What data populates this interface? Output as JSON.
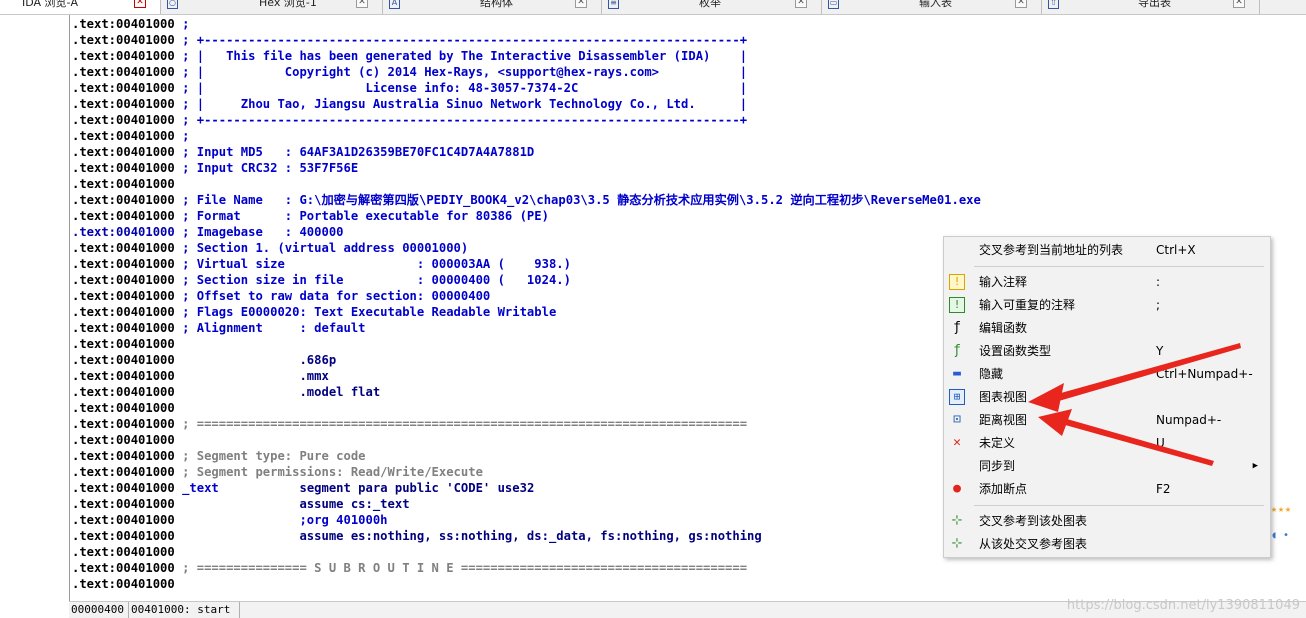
{
  "tabs": [
    {
      "label": "IDA 浏览-A",
      "icon": "ida-view-icon",
      "active": true
    },
    {
      "label": "Hex 浏览-1",
      "icon": "hex-view-icon",
      "active": false
    },
    {
      "label": "结构体",
      "icon": "structures-icon",
      "active": false
    },
    {
      "label": "枚举",
      "icon": "enums-icon",
      "active": false
    },
    {
      "label": "输入表",
      "icon": "imports-icon",
      "active": false
    },
    {
      "label": "导出表",
      "icon": "exports-icon",
      "active": false
    }
  ],
  "code_lines": [
    [
      ".text:00401000",
      " ;"
    ],
    [
      ".text:00401000",
      " ; +-------------------------------------------------------------------------+"
    ],
    [
      ".text:00401000",
      " ; |   This file has been generated by The Interactive Disassembler (IDA)    |"
    ],
    [
      ".text:00401000",
      " ; |           Copyright (c) 2014 Hex-Rays, <support@hex-rays.com>           |"
    ],
    [
      ".text:00401000",
      " ; |                      License info: 48-3057-7374-2C                      |"
    ],
    [
      ".text:00401000",
      " ; |     Zhou Tao, Jiangsu Australia Sinuo Network Technology Co., Ltd.      |"
    ],
    [
      ".text:00401000",
      " ; +-------------------------------------------------------------------------+"
    ],
    [
      ".text:00401000",
      " ;"
    ],
    [
      ".text:00401000",
      " ; Input MD5   : 64AF3A1D26359BE70FC1C4D7A4A7881D"
    ],
    [
      ".text:00401000",
      " ; Input CRC32 : 53F7F56E"
    ],
    [
      ".text:00401000",
      ""
    ],
    [
      ".text:00401000",
      " ; File Name   : G:\\加密与解密第四版\\PEDIY_BOOK4_v2\\chap03\\3.5 静态分析技术应用实例\\3.5.2 逆向工程初步\\ReverseMe01.exe"
    ],
    [
      ".text:00401000",
      " ; Format      : Portable executable for 80386 (PE)"
    ],
    [
      ".text:00401000",
      " ; Imagebase   : 400000"
    ],
    [
      ".text:00401000",
      " ; Section 1. (virtual address 00001000)"
    ],
    [
      ".text:00401000",
      " ; Virtual size                  : 000003AA (    938.)"
    ],
    [
      ".text:00401000",
      " ; Section size in file          : 00000400 (   1024.)"
    ],
    [
      ".text:00401000",
      " ; Offset to raw data for section: 00000400"
    ],
    [
      ".text:00401000",
      " ; Flags E0000020: Text Executable Readable Writable"
    ],
    [
      ".text:00401000",
      " ; Alignment     : default"
    ],
    [
      ".text:00401000",
      ""
    ],
    [
      ".text:00401000",
      "                 .686p"
    ],
    [
      ".text:00401000",
      "                 .mmx"
    ],
    [
      ".text:00401000",
      "                 .model flat"
    ],
    [
      ".text:00401000",
      ""
    ],
    [
      ".text:00401000",
      " ; ==========================================================================="
    ],
    [
      ".text:00401000",
      ""
    ],
    [
      ".text:00401000",
      " ; Segment type: Pure code"
    ],
    [
      ".text:00401000",
      " ; Segment permissions: Read/Write/Execute"
    ],
    [
      ".text:00401000",
      " _text           segment para public 'CODE' use32"
    ],
    [
      ".text:00401000",
      "                 assume cs:_text"
    ],
    [
      ".text:00401000",
      "                 ;org 401000h"
    ],
    [
      ".text:00401000",
      "                 assume es:nothing, ss:nothing, ds:_data, fs:nothing, gs:nothing"
    ],
    [
      ".text:00401000",
      ""
    ],
    [
      ".text:00401000",
      " ; =============== S U B R O U T I N E ======================================="
    ],
    [
      ".text:00401000",
      ""
    ]
  ],
  "status": {
    "offset": "00000400",
    "location": "00401000: start"
  },
  "watermark": "https://blog.csdn.net/ly1390811049",
  "context_menu": [
    {
      "label": "交叉参考到当前地址的列表",
      "key": "Ctrl+X",
      "icon": ""
    },
    {
      "sep": true
    },
    {
      "label": "输入注释",
      "key": ":",
      "icon": "comment-icon"
    },
    {
      "label": "输入可重复的注释",
      "key": ";",
      "icon": "repeatable-comment-icon"
    },
    {
      "label": "编辑函数",
      "key": "",
      "icon": "function-icon"
    },
    {
      "label": "设置函数类型",
      "key": "Y",
      "icon": "function-type-icon"
    },
    {
      "label": "隐藏",
      "key": "Ctrl+Numpad+-",
      "icon": "hide-icon"
    },
    {
      "label": "图表视图",
      "key": "",
      "icon": "graph-view-icon"
    },
    {
      "label": "距离视图",
      "key": "Numpad+-",
      "icon": "proximity-view-icon"
    },
    {
      "label": "未定义",
      "key": "U",
      "icon": "undefine-icon"
    },
    {
      "label": "同步到",
      "key": "",
      "icon": "",
      "submenu": true
    },
    {
      "label": "添加断点",
      "key": "F2",
      "icon": "breakpoint-icon"
    },
    {
      "sep": true
    },
    {
      "label": "交叉参考到该处图表",
      "key": "",
      "icon": "xrefs-to-graph-icon"
    },
    {
      "label": "从该处交叉参考图表",
      "key": "",
      "icon": "xrefs-from-graph-icon"
    }
  ],
  "colors": {
    "comment": "#0000cc",
    "gray_comment": "#808080",
    "arrow": "#e8261e"
  }
}
